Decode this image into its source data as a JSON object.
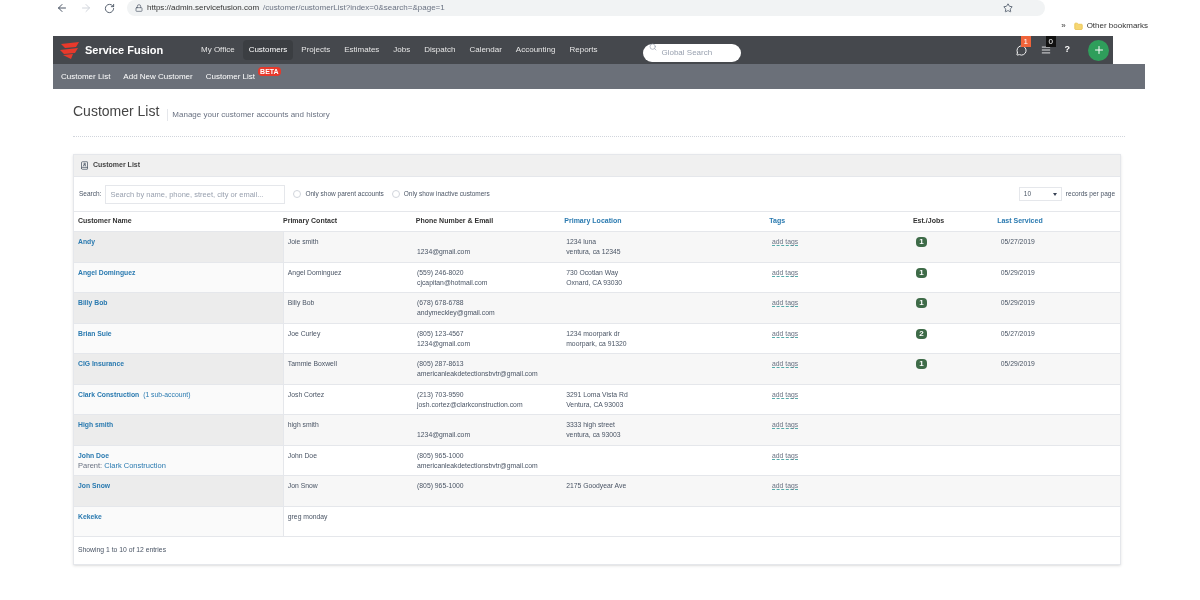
{
  "browser": {
    "url_host": "https://admin.servicefusion.com",
    "url_path": "/customer/customerList?index=0&search=&page=1",
    "bookmarks_more": "»",
    "bookmarks": "Other bookmarks"
  },
  "app": {
    "logo": "Service Fusion",
    "nav": [
      {
        "label": "My Office",
        "selected": false
      },
      {
        "label": "Customers",
        "selected": true
      },
      {
        "label": "Projects",
        "selected": false
      },
      {
        "label": "Estimates",
        "selected": false
      },
      {
        "label": "Jobs",
        "selected": false
      },
      {
        "label": "Dispatch",
        "selected": false
      },
      {
        "label": "Calendar",
        "selected": false
      },
      {
        "label": "Accounting",
        "selected": false
      },
      {
        "label": "Reports",
        "selected": false
      }
    ],
    "global_search": {
      "placeholder": "Global Search"
    },
    "messages_badge": "1",
    "tasks_badge": "0",
    "help": "?",
    "subnav": [
      {
        "label": "Customer List"
      },
      {
        "label": "Add New Customer"
      },
      {
        "label": "Customer List",
        "badge": "BETA"
      }
    ]
  },
  "page": {
    "title": "Customer List",
    "subtitle": "Manage your customer accounts and history"
  },
  "panel": {
    "title": "Customer List",
    "search_label": "Search:",
    "search": {
      "placeholder": "Search by name, phone, street, city or email..."
    },
    "filters": [
      {
        "label": "Only show parent accounts",
        "checked": false
      },
      {
        "label": "Only show inactive customers",
        "checked": false
      }
    ],
    "page_size": "10",
    "page_size_label": "records per page",
    "columns": [
      {
        "label": "Customer Name",
        "sortable": false
      },
      {
        "label": "Primary Contact",
        "sortable": false
      },
      {
        "label": "Phone Number & Email",
        "sortable": false
      },
      {
        "label": "Primary Location",
        "sortable": true
      },
      {
        "label": "Tags",
        "sortable": true
      },
      {
        "label": "Est./Jobs",
        "sortable": false
      },
      {
        "label": "Last Serviced",
        "sortable": true
      }
    ],
    "rows": [
      {
        "name": "Andy",
        "contact": "Joie smith",
        "email": "1234@gmail.com",
        "address": [
          "1234 luna",
          "ventura, ca 12345"
        ],
        "tags": "add tags",
        "jobs": "1",
        "last": "05/27/2019"
      },
      {
        "name": "Angel Dominguez",
        "contact": "Angel Dominguez",
        "phone": "(559) 246-8020",
        "email": "cjcapitan@hotmail.com",
        "address": [
          "730 Ocotlan Way",
          "Oxnard, CA 93030"
        ],
        "tags": "add tags",
        "jobs": "1",
        "last": "05/29/2019"
      },
      {
        "name": "Billy Bob",
        "contact": "Billy Bob",
        "phone": "(678) 678-6788",
        "email": "andymeckley@gmail.com",
        "tags": "add tags",
        "jobs": "1",
        "last": "05/29/2019"
      },
      {
        "name": "Brian Suie",
        "contact": "Joe Curley",
        "phone": "(805) 123-4567",
        "email": "1234@gmail.com",
        "address": [
          "1234 moorpark dr",
          "moorpark, ca 91320"
        ],
        "tags": "add tags",
        "jobs": "2",
        "last": "05/27/2019"
      },
      {
        "name": "CIG Insurance",
        "contact": "Tammie Boxwell",
        "phone": "(805) 287-8613",
        "email": "americanleakdetectionsbvtr@gmail.com",
        "tags": "add tags",
        "jobs": "1",
        "last": "05/29/2019"
      },
      {
        "name": "Clark Construction",
        "sub_accounts": "(1 sub-account)",
        "contact": "Josh Cortez",
        "phone": "(213) 703-9590",
        "email": "josh.cortez@clarkconstruction.com",
        "address": [
          "3291 Loma Vista Rd",
          "Ventura, CA 93003"
        ],
        "tags": "add tags"
      },
      {
        "name": "High smith",
        "contact": "high smith",
        "email": "1234@gmail.com",
        "address": [
          "3333 high street",
          "ventura, ca 93003"
        ],
        "tags": "add tags"
      },
      {
        "name": "John Doe",
        "parent_label": "Parent:",
        "parent": "Clark Construction",
        "contact": "John Doe",
        "phone": "(805) 965-1000",
        "email": "americanleakdetectionsbvtr@gmail.com",
        "tags": "add tags"
      },
      {
        "name": "Jon Snow",
        "contact": "Jon Snow",
        "phone": "(805) 965-1000",
        "address": [
          "2175 Goodyear Ave"
        ],
        "tags": "add tags"
      },
      {
        "name": "Kekeke",
        "contact": "greg monday"
      }
    ],
    "footer": "Showing 1 to 10 of 12 entries"
  }
}
